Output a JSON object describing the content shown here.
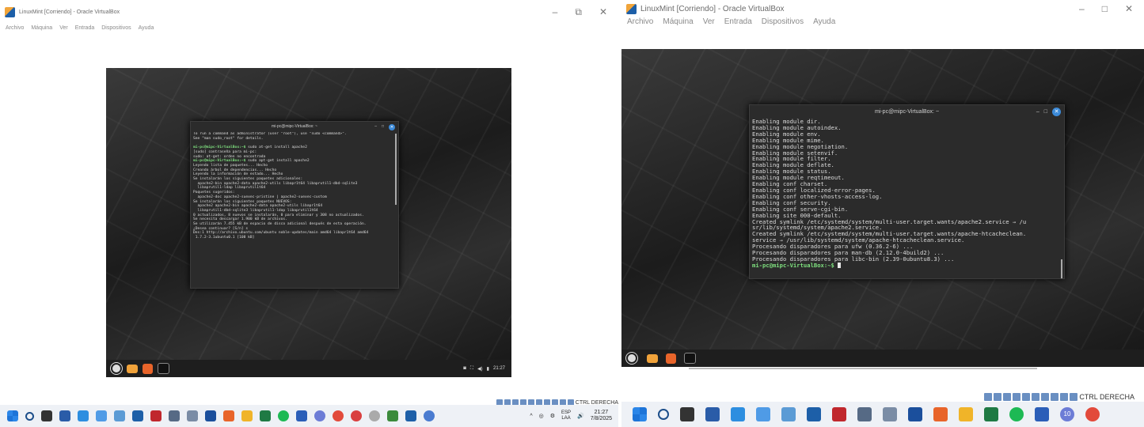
{
  "left": {
    "window_title": "LinuxMint [Corriendo] - Oracle VirtualBox",
    "menu": [
      "Archivo",
      "Máquina",
      "Ver",
      "Entrada",
      "Dispositivos",
      "Ayuda"
    ],
    "terminal_title": "mi-pc@mipc-VirtualBox: ~",
    "terminal_lines": [
      {
        "t": "To run a command as administrator (user \"root\"), use \"sudo <command>\".",
        "p": false
      },
      {
        "t": "See \"man sudo_root\" for details.",
        "p": false
      },
      {
        "t": "",
        "p": false
      },
      {
        "t": "mi-pc@mipc-VirtualBox:~$ sudo at-get install apache2",
        "p": true
      },
      {
        "t": "[sudo] contraseña para mi-pc:",
        "p": false
      },
      {
        "t": "sudo: at-get: orden no encontrada",
        "p": false
      },
      {
        "t": "mi-pc@mipc-VirtualBox:~$ sudo apt-get install apache2",
        "p": true
      },
      {
        "t": "Leyendo lista de paquetes... Hecho",
        "p": false
      },
      {
        "t": "Creando árbol de dependencias... Hecho",
        "p": false
      },
      {
        "t": "Leyendo la información de estado... Hecho",
        "p": false
      },
      {
        "t": "Se instalarán los siguientes paquetes adicionales:",
        "p": false
      },
      {
        "t": "  apache2-bin apache2-data apache2-utils libapr1t64 libaprutil1-dbd-sqlite3",
        "p": false
      },
      {
        "t": "  libaprutil1-ldap libaprutil1t64",
        "p": false
      },
      {
        "t": "Paquetes sugeridos:",
        "p": false
      },
      {
        "t": "  apache2-doc apache2-suexec-pristine | apache2-suexec-custom",
        "p": false
      },
      {
        "t": "Se instalarán los siguientes paquetes NUEVOS:",
        "p": false
      },
      {
        "t": "  apache2 apache2-bin apache2-data apache2-utils libapr1t64",
        "p": false
      },
      {
        "t": "  libaprutil1-dbd-sqlite3 libaprutil1-ldap libaprutil1t64",
        "p": false
      },
      {
        "t": "0 actualizados, 8 nuevos se instalarán, 0 para eliminar y 308 no actualizados.",
        "p": false
      },
      {
        "t": "Se necesita descargar 1.900 kB de archivos.",
        "p": false
      },
      {
        "t": "Se utilizarán 7.455 kB de espacio de disco adicional después de esta operación.",
        "p": false
      },
      {
        "t": "¿Desea continuar? [S/n] s",
        "p": false
      },
      {
        "t": "Des:1 http://archivo.ubuntu.com/ubuntu noble-updates/main amd64 libapr1t64 amd64",
        "p": false
      },
      {
        "t": " 1.7.2-3.1ubuntu0.1 [108 kB]",
        "p": false
      }
    ],
    "mint_clock": "21:27",
    "status_label": "CTRL DERECHA",
    "lang": "ESP",
    "lang2": "LAA",
    "time": "21:27",
    "date": "7/8/2025"
  },
  "right": {
    "window_title": "LinuxMint [Corriendo] - Oracle VirtualBox",
    "menu": [
      "Archivo",
      "Máquina",
      "Ver",
      "Entrada",
      "Dispositivos",
      "Ayuda"
    ],
    "terminal_title": "mi-pc@mipc-VirtualBox: ~",
    "terminal_lines": [
      {
        "t": "Enabling module dir.",
        "p": false
      },
      {
        "t": "Enabling module autoindex.",
        "p": false
      },
      {
        "t": "Enabling module env.",
        "p": false
      },
      {
        "t": "Enabling module mime.",
        "p": false
      },
      {
        "t": "Enabling module negotiation.",
        "p": false
      },
      {
        "t": "Enabling module setenvif.",
        "p": false
      },
      {
        "t": "Enabling module filter.",
        "p": false
      },
      {
        "t": "Enabling module deflate.",
        "p": false
      },
      {
        "t": "Enabling module status.",
        "p": false
      },
      {
        "t": "Enabling module reqtimeout.",
        "p": false
      },
      {
        "t": "Enabling conf charset.",
        "p": false
      },
      {
        "t": "Enabling conf localized-error-pages.",
        "p": false
      },
      {
        "t": "Enabling conf other-vhosts-access-log.",
        "p": false
      },
      {
        "t": "Enabling conf security.",
        "p": false
      },
      {
        "t": "Enabling conf serve-cgi-bin.",
        "p": false
      },
      {
        "t": "Enabling site 000-default.",
        "p": false
      },
      {
        "t": "Created symlink /etc/systemd/system/multi-user.target.wants/apache2.service → /u",
        "p": false
      },
      {
        "t": "sr/lib/systemd/system/apache2.service.",
        "p": false
      },
      {
        "t": "Created symlink /etc/systemd/system/multi-user.target.wants/apache-htcacheclean.",
        "p": false
      },
      {
        "t": "service → /usr/lib/systemd/system/apache-htcacheclean.service.",
        "p": false
      },
      {
        "t": "Procesando disparadores para ufw (0.36.2-6) ...",
        "p": false
      },
      {
        "t": "Procesando disparadores para man-db (2.12.0-4build2) ...",
        "p": false
      },
      {
        "t": "Procesando disparadores para libc-bin (2.39-0ubuntu8.3) ...",
        "p": false
      },
      {
        "t": "mi-pc@mipc-VirtualBox:~$ ",
        "p": true
      }
    ],
    "status_label": "CTRL DERECHA",
    "chrome_badge": "10"
  }
}
